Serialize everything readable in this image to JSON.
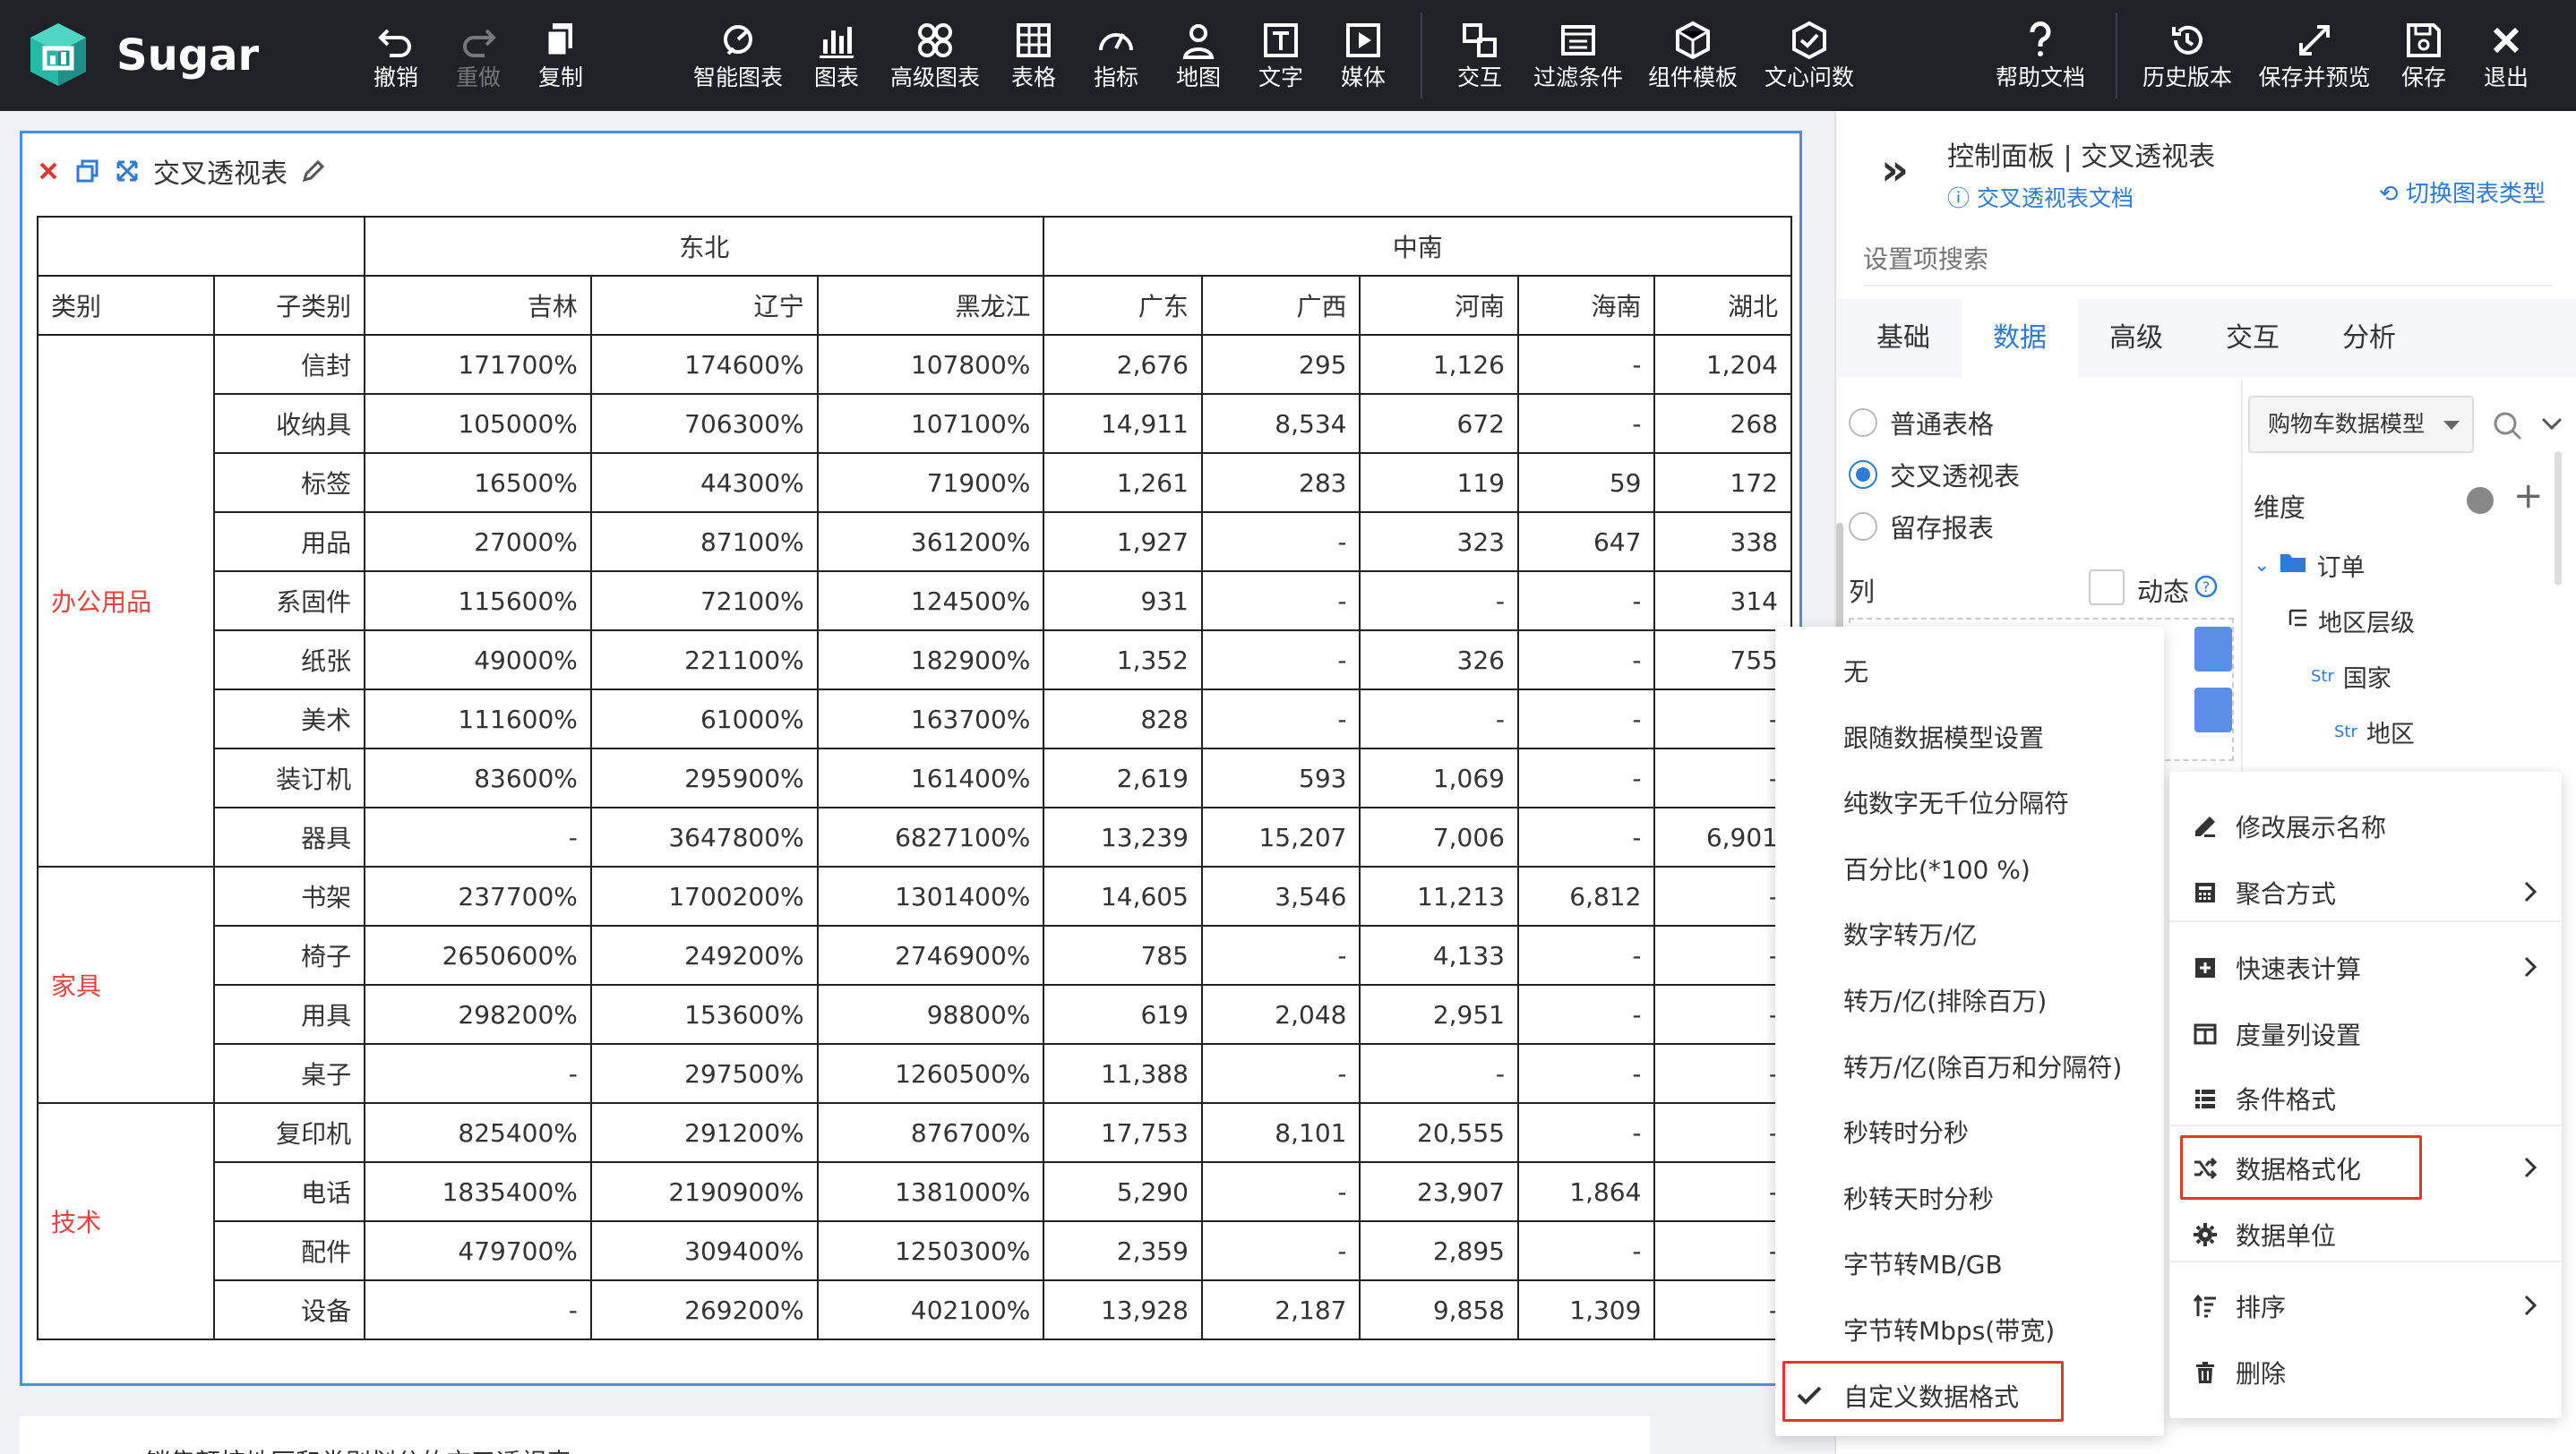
{
  "toolbar": {
    "brand": "Sugar",
    "items": [
      {
        "id": "undo",
        "label": "撤销",
        "icon": "undo-icon"
      },
      {
        "id": "redo",
        "label": "重做",
        "icon": "redo-icon",
        "disabled": true
      },
      {
        "id": "copy",
        "label": "复制",
        "icon": "copy-icon"
      },
      {
        "id": "smart",
        "label": "智能图表",
        "icon": "smart-chart-icon"
      },
      {
        "id": "chart",
        "label": "图表",
        "icon": "bar-chart-icon"
      },
      {
        "id": "adv",
        "label": "高级图表",
        "icon": "advanced-chart-icon"
      },
      {
        "id": "table",
        "label": "表格",
        "icon": "table-icon"
      },
      {
        "id": "metric",
        "label": "指标",
        "icon": "gauge-icon"
      },
      {
        "id": "map",
        "label": "地图",
        "icon": "map-pin-icon"
      },
      {
        "id": "text",
        "label": "文字",
        "icon": "text-icon"
      },
      {
        "id": "media",
        "label": "媒体",
        "icon": "media-icon"
      },
      {
        "id": "interact",
        "label": "交互",
        "icon": "interaction-icon"
      },
      {
        "id": "filter",
        "label": "过滤条件",
        "icon": "filter-icon"
      },
      {
        "id": "template",
        "label": "组件模板",
        "icon": "cube-icon"
      },
      {
        "id": "ask",
        "label": "文心问数",
        "icon": "ai-ask-icon"
      },
      {
        "id": "help",
        "label": "帮助文档",
        "icon": "help-icon"
      },
      {
        "id": "history",
        "label": "历史版本",
        "icon": "history-icon"
      },
      {
        "id": "savepreview",
        "label": "保存并预览",
        "icon": "expand-icon"
      },
      {
        "id": "save",
        "label": "保存",
        "icon": "save-icon"
      },
      {
        "id": "exit",
        "label": "退出",
        "icon": "close-icon"
      }
    ]
  },
  "card": {
    "title": "交叉透视表",
    "below_text": "销售额按地区和类别划分的交叉透视表"
  },
  "pivot": {
    "region_headers": [
      {
        "label": "东北"
      },
      {
        "label": "中南"
      }
    ],
    "row_headers": [
      "类别",
      "子类别"
    ],
    "columns": [
      "吉林",
      "辽宁",
      "黑龙江",
      "广东",
      "广西",
      "河南",
      "海南",
      "湖北"
    ],
    "groups": [
      {
        "category": "办公用品",
        "rows": [
          {
            "sub": "信封",
            "vals": [
              "171700%",
              "174600%",
              "107800%",
              "2,676",
              "295",
              "1,126",
              "-",
              "1,204"
            ]
          },
          {
            "sub": "收纳具",
            "vals": [
              "105000%",
              "706300%",
              "107100%",
              "14,911",
              "8,534",
              "672",
              "-",
              "268"
            ]
          },
          {
            "sub": "标签",
            "vals": [
              "16500%",
              "44300%",
              "71900%",
              "1,261",
              "283",
              "119",
              "59",
              "172"
            ]
          },
          {
            "sub": "用品",
            "vals": [
              "27000%",
              "87100%",
              "361200%",
              "1,927",
              "-",
              "323",
              "647",
              "338"
            ]
          },
          {
            "sub": "系固件",
            "vals": [
              "115600%",
              "72100%",
              "124500%",
              "931",
              "-",
              "-",
              "-",
              "314"
            ]
          },
          {
            "sub": "纸张",
            "vals": [
              "49000%",
              "221100%",
              "182900%",
              "1,352",
              "-",
              "326",
              "-",
              "755"
            ]
          },
          {
            "sub": "美术",
            "vals": [
              "111600%",
              "61000%",
              "163700%",
              "828",
              "-",
              "-",
              "-",
              "-"
            ]
          },
          {
            "sub": "装订机",
            "vals": [
              "83600%",
              "295900%",
              "161400%",
              "2,619",
              "593",
              "1,069",
              "-",
              "-"
            ]
          },
          {
            "sub": "器具",
            "vals": [
              "-",
              "3647800%",
              "6827100%",
              "13,239",
              "15,207",
              "7,006",
              "-",
              "6,901"
            ]
          }
        ]
      },
      {
        "category": "家具",
        "rows": [
          {
            "sub": "书架",
            "vals": [
              "237700%",
              "1700200%",
              "1301400%",
              "14,605",
              "3,546",
              "11,213",
              "6,812",
              "-"
            ]
          },
          {
            "sub": "椅子",
            "vals": [
              "2650600%",
              "249200%",
              "2746900%",
              "785",
              "-",
              "4,133",
              "-",
              "-"
            ]
          },
          {
            "sub": "用具",
            "vals": [
              "298200%",
              "153600%",
              "98800%",
              "619",
              "2,048",
              "2,951",
              "-",
              "-"
            ]
          },
          {
            "sub": "桌子",
            "vals": [
              "-",
              "297500%",
              "1260500%",
              "11,388",
              "-",
              "-",
              "-",
              "-"
            ]
          }
        ]
      },
      {
        "category": "技术",
        "rows": [
          {
            "sub": "复印机",
            "vals": [
              "825400%",
              "291200%",
              "876700%",
              "17,753",
              "8,101",
              "20,555",
              "-",
              "-"
            ]
          },
          {
            "sub": "电话",
            "vals": [
              "1835400%",
              "2190900%",
              "1381000%",
              "5,290",
              "-",
              "23,907",
              "1,864",
              "-"
            ]
          },
          {
            "sub": "配件",
            "vals": [
              "479700%",
              "309400%",
              "1250300%",
              "2,359",
              "-",
              "2,895",
              "-",
              "-"
            ]
          },
          {
            "sub": "设备",
            "vals": [
              "-",
              "269200%",
              "402100%",
              "13,928",
              "2,187",
              "9,858",
              "1,309",
              "-"
            ]
          }
        ]
      }
    ]
  },
  "panel": {
    "title": "控制面板 | 交叉透视表",
    "doc_link": "交叉透视表文档",
    "switch_type": "切换图表类型",
    "search_placeholder": "设置项搜索",
    "tabs": [
      "基础",
      "数据",
      "高级",
      "交互",
      "分析"
    ],
    "active_tab": "数据",
    "table_types": [
      {
        "label": "普通表格",
        "selected": false
      },
      {
        "label": "交叉透视表",
        "selected": true
      },
      {
        "label": "留存报表",
        "selected": false
      }
    ],
    "column_label": "列",
    "dynamic_label": "动态",
    "dataset": "购物车数据模型",
    "dimension_label": "维度",
    "tree": [
      {
        "label": "订单",
        "type": "folder"
      },
      {
        "label": "地区层级",
        "type": "hierarchy"
      },
      {
        "label": "国家",
        "type": "Str"
      },
      {
        "label": "地区",
        "type": "Str"
      }
    ]
  },
  "context_menu": [
    {
      "label": "修改展示名称",
      "icon": "edit-icon",
      "submenu": false
    },
    {
      "label": "聚合方式",
      "icon": "calculator-icon",
      "submenu": true
    },
    {
      "label": "快速表计算",
      "icon": "plus-box-icon",
      "submenu": true
    },
    {
      "label": "度量列设置",
      "icon": "columns-icon",
      "submenu": false
    },
    {
      "label": "条件格式",
      "icon": "list-icon",
      "submenu": false
    },
    {
      "label": "数据格式化",
      "icon": "shuffle-icon",
      "submenu": true,
      "highlighted": true
    },
    {
      "label": "数据单位",
      "icon": "gear-icon",
      "submenu": false
    },
    {
      "label": "排序",
      "icon": "sort-icon",
      "submenu": true
    },
    {
      "label": "删除",
      "icon": "trash-icon",
      "submenu": false
    }
  ],
  "format_menu": [
    {
      "label": "无"
    },
    {
      "label": "跟随数据模型设置"
    },
    {
      "label": "纯数字无千位分隔符"
    },
    {
      "label": "百分比(*100 %)"
    },
    {
      "label": "数字转万/亿"
    },
    {
      "label": "转万/亿(排除百万)"
    },
    {
      "label": "转万/亿(除百万和分隔符)"
    },
    {
      "label": "秒转时分秒"
    },
    {
      "label": "秒转天时分秒"
    },
    {
      "label": "字节转MB/GB"
    },
    {
      "label": "字节转Mbps(带宽)"
    },
    {
      "label": "自定义数据格式",
      "checked": true,
      "highlighted": true
    }
  ],
  "colors": {
    "topbar": "#1f2126",
    "accent": "#2f7ad6",
    "category_text": "#e64340",
    "highlight_border": "#e0382e",
    "selection_border": "#4a90e2"
  }
}
